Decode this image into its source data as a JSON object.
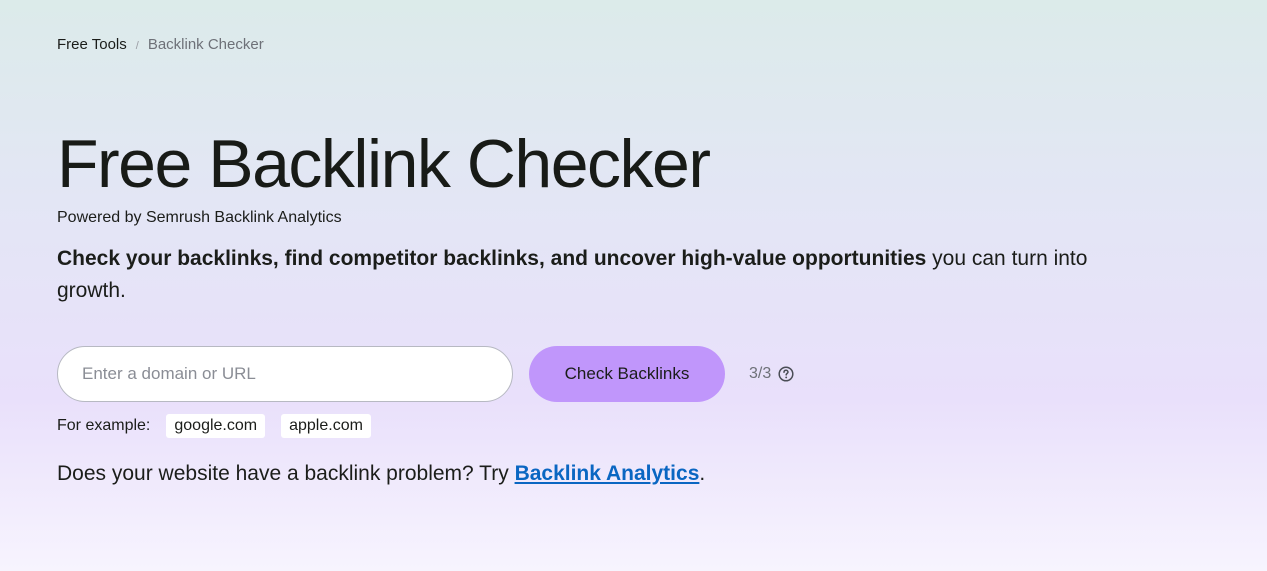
{
  "breadcrumb": {
    "items": [
      {
        "label": "Free Tools"
      },
      {
        "label": "Backlink Checker"
      }
    ],
    "separator": "/"
  },
  "hero": {
    "title": "Free Backlink Checker",
    "powered_by": "Powered by Semrush Backlink Analytics",
    "lead_bold": "Check your backlinks, find competitor backlinks, and uncover high-value opportunities",
    "lead_rest": " you can turn into growth."
  },
  "search": {
    "placeholder": "Enter a domain or URL",
    "value": "",
    "button_label": "Check Backlinks",
    "limit_text": "3/3",
    "help_icon": "question-circle-icon"
  },
  "examples": {
    "label": "For example:",
    "items": [
      "google.com",
      "apple.com"
    ]
  },
  "promo": {
    "text_before": "Does your website have a backlink problem? Try ",
    "link_text": "Backlink Analytics",
    "text_after": "."
  },
  "colors": {
    "button": "#c096fb",
    "link": "#0a66c2",
    "text": "#1b1d1a"
  }
}
